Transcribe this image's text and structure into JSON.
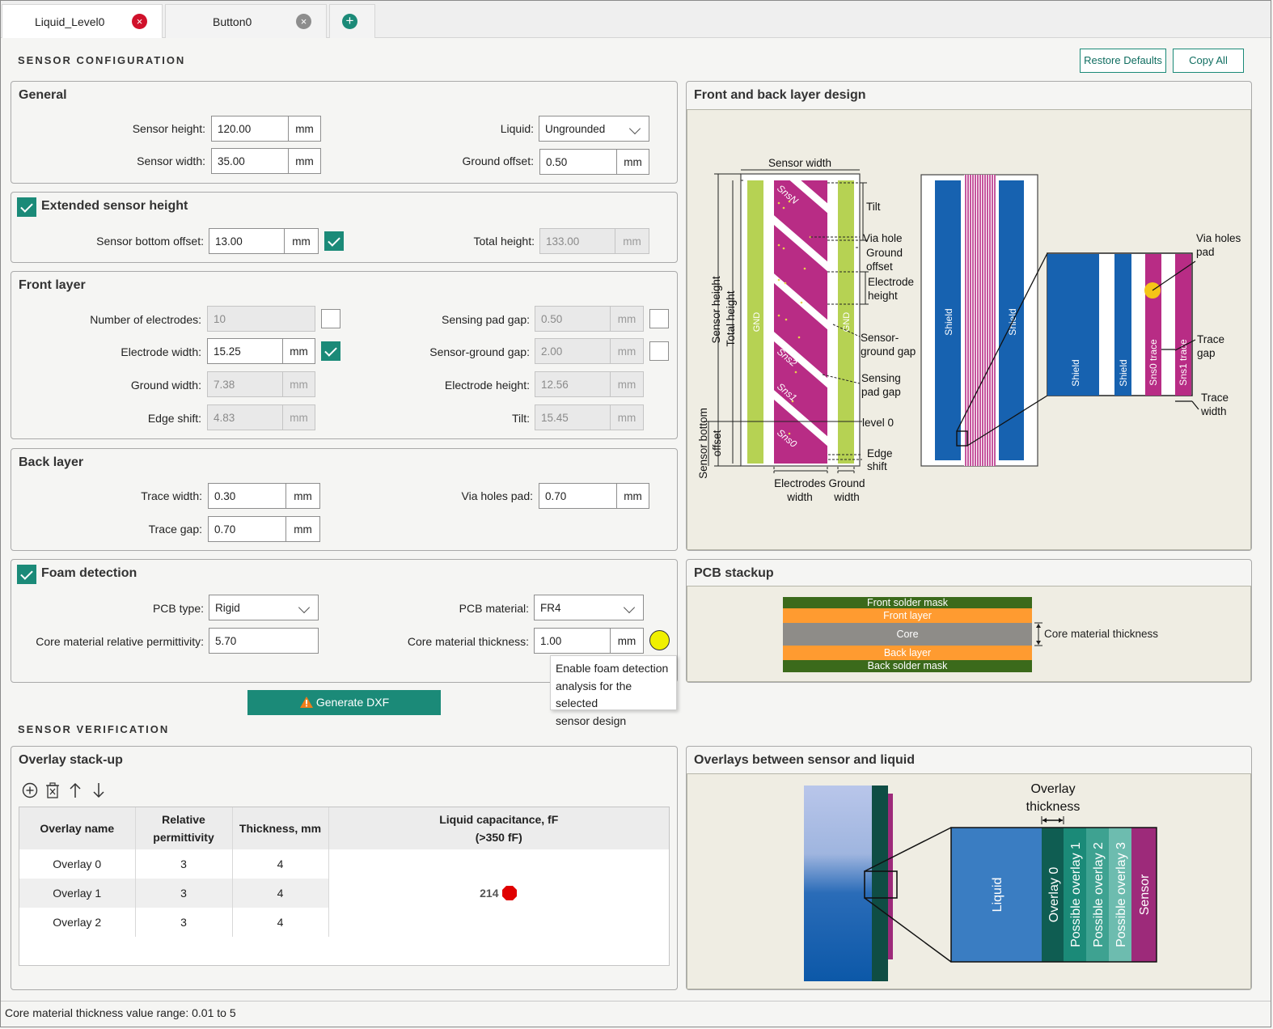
{
  "tabs": [
    {
      "label": "Liquid_Level0",
      "close": "×"
    },
    {
      "label": "Button0",
      "close": "×"
    },
    {
      "add": "+"
    }
  ],
  "sensor_config": {
    "heading": "SENSOR CONFIGURATION",
    "restore_label": "Restore Defaults",
    "copy_label": "Copy All"
  },
  "general": {
    "title": "General",
    "sensor_height": {
      "label": "Sensor height:",
      "value": "120.00",
      "unit": "mm"
    },
    "sensor_width": {
      "label": "Sensor width:",
      "value": "35.00",
      "unit": "mm"
    },
    "liquid": {
      "label": "Liquid:",
      "value": "Ungrounded"
    },
    "ground_offset": {
      "label": "Ground offset:",
      "value": "0.50",
      "unit": "mm"
    }
  },
  "extended": {
    "title": "Extended sensor height",
    "enabled": true,
    "bottom_offset": {
      "label": "Sensor bottom offset:",
      "value": "13.00",
      "unit": "mm",
      "auto": true
    },
    "total_height": {
      "label": "Total height:",
      "value": "133.00",
      "unit": "mm"
    }
  },
  "front": {
    "title": "Front layer",
    "num_electrodes": {
      "label": "Number of electrodes:",
      "value": "10",
      "auto": false
    },
    "electrode_width": {
      "label": "Electrode width:",
      "value": "15.25",
      "unit": "mm",
      "auto": true
    },
    "ground_width": {
      "label": "Ground width:",
      "value": "7.38",
      "unit": "mm"
    },
    "edge_shift": {
      "label": "Edge shift:",
      "value": "4.83",
      "unit": "mm"
    },
    "sensing_pad_gap": {
      "label": "Sensing pad gap:",
      "value": "0.50",
      "unit": "mm",
      "auto": false
    },
    "sensor_ground_gap": {
      "label": "Sensor-ground gap:",
      "value": "2.00",
      "unit": "mm",
      "auto": false
    },
    "electrode_height": {
      "label": "Electrode height:",
      "value": "12.56",
      "unit": "mm"
    },
    "tilt": {
      "label": "Tilt:",
      "value": "15.45",
      "unit": "mm"
    }
  },
  "back": {
    "title": "Back layer",
    "trace_width": {
      "label": "Trace width:",
      "value": "0.30",
      "unit": "mm"
    },
    "trace_gap": {
      "label": "Trace gap:",
      "value": "0.70",
      "unit": "mm"
    },
    "via_holes_pad": {
      "label": "Via holes pad:",
      "value": "0.70",
      "unit": "mm"
    }
  },
  "foam": {
    "title": "Foam detection",
    "enabled": true,
    "pcb_type": {
      "label": "PCB type:",
      "value": "Rigid"
    },
    "permittivity": {
      "label": "Core material relative permittivity:",
      "value": "5.70"
    },
    "pcb_material": {
      "label": "PCB material:",
      "value": "FR4"
    },
    "core_thickness": {
      "label": "Core material thickness:",
      "value": "1.00",
      "unit": "mm"
    },
    "status_color": "#f0f000",
    "tooltip": [
      "Enable foam detection",
      "analysis for the selected",
      "sensor design"
    ]
  },
  "generate_label": "Generate DXF",
  "front_back_design": {
    "title": "Front and back layer design",
    "labels": {
      "sensor_width": "Sensor width",
      "sensor_height": "Sensor height",
      "total_height": "Total height",
      "sensor_bottom": "Sensor bottom",
      "offset": "offset",
      "tilt": "Tilt",
      "via_hole": "Via hole",
      "ground": "Ground",
      "offset2": "offset",
      "electrode": "Electrode",
      "height": "height",
      "sensor_dash": "Sensor-",
      "ground_gap": "ground gap",
      "sensing": "Sensing",
      "pad_gap": "pad gap",
      "level0": "level 0",
      "edge": "Edge",
      "shift": "shift",
      "electrodes": "Electrodes",
      "width": "width",
      "ground_w": "Ground",
      "width2": "width",
      "gnd": "GND",
      "sns_n": "SnsN",
      "sns2": "Sns2",
      "sns1": "Sns1",
      "sns0": "Sns0",
      "shield": "Shield",
      "via_holes": "Via holes",
      "pad": "pad",
      "sns0_trace": "Sns0 trace",
      "sns1_trace": "Sns1 trace",
      "trace": "Trace",
      "gap": "gap",
      "trace2": "Trace",
      "width3": "width"
    }
  },
  "pcb_stackup": {
    "title": "PCB stackup",
    "layers": [
      "Front solder mask",
      "Front layer",
      "Core",
      "Back layer",
      "Back solder mask"
    ],
    "core_label": "Core material thickness"
  },
  "sensor_verification": {
    "heading": "SENSOR VERIFICATION"
  },
  "overlay_stackup": {
    "title": "Overlay stack-up",
    "columns": [
      "Overlay name",
      "Relative",
      "permittivity",
      "Thickness, mm",
      "Liquid capacitance, fF",
      "(>350 fF)"
    ],
    "rows": [
      {
        "name": "Overlay 0",
        "perm": "3",
        "thick": "4"
      },
      {
        "name": "Overlay 1",
        "perm": "3",
        "thick": "4"
      },
      {
        "name": "Overlay 2",
        "perm": "3",
        "thick": "4"
      }
    ],
    "capacitance": "214",
    "cap_status_color": "#e00000"
  },
  "overlays_diagram": {
    "title": "Overlays between sensor and liquid",
    "thickness_label_1": "Overlay",
    "thickness_label_2": "thickness",
    "bands": [
      "Liquid",
      "Overlay 0",
      "Possible overlay 1",
      "Possible overlay 2",
      "Possible overlay 3",
      "Sensor"
    ]
  },
  "status": "Core material thickness value range: 0.01 to 5"
}
